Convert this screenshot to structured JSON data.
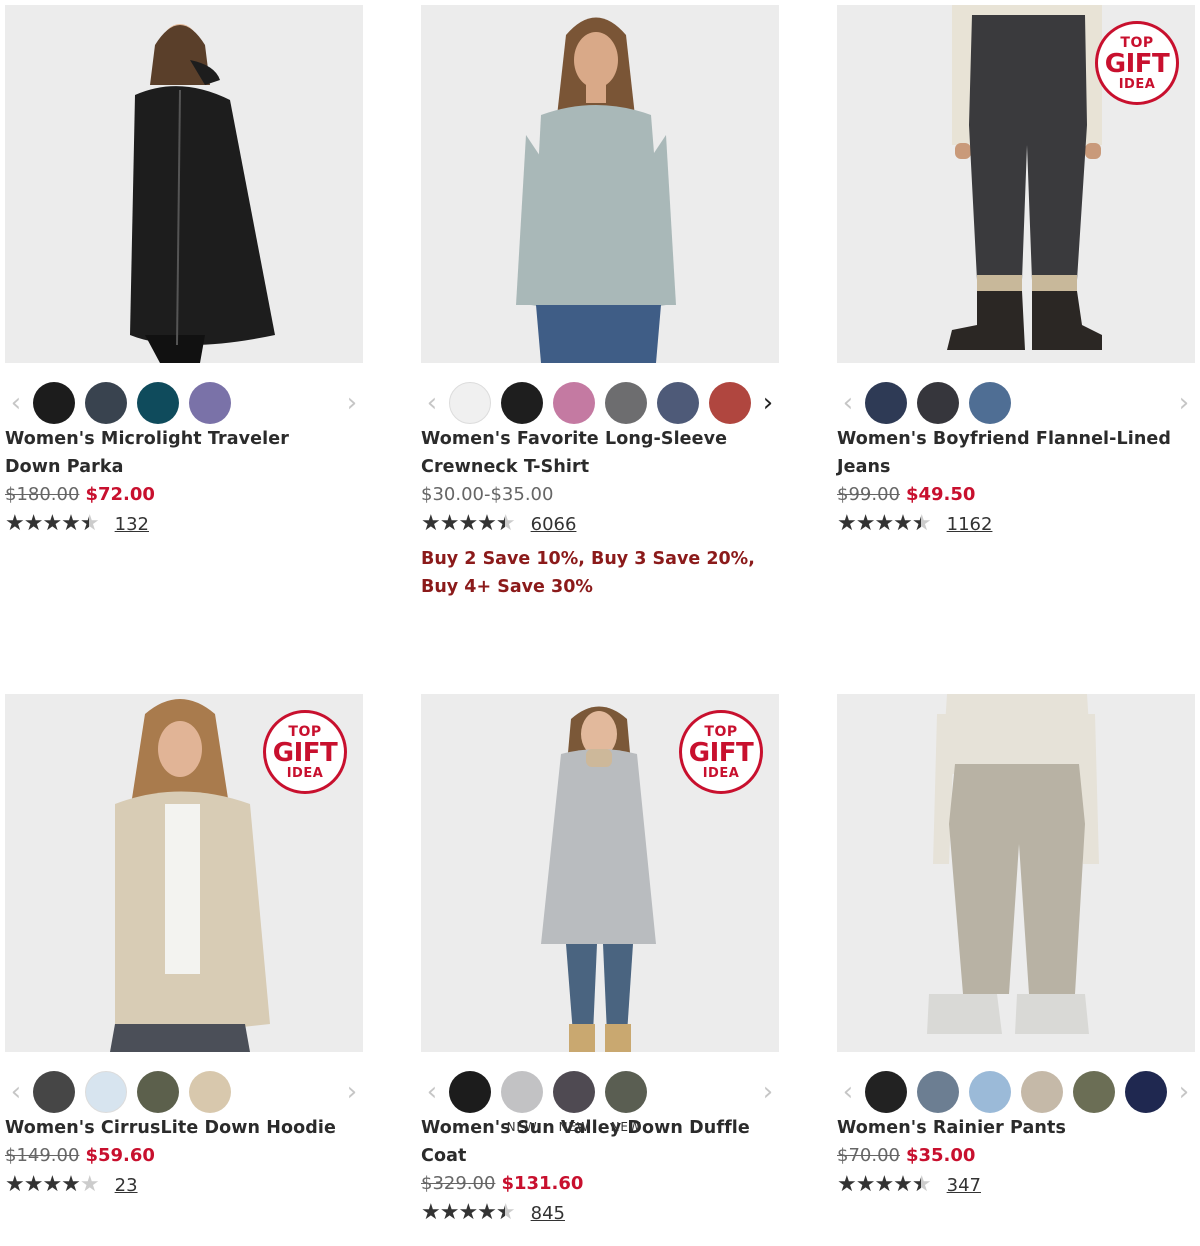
{
  "products": [
    {
      "title": "Women's Microlight Traveler Down Parka",
      "was_price": "$180.00",
      "now_price": "$72.00",
      "rating": 4.5,
      "review_count": "132",
      "badge": null,
      "swatches": [
        "#1c1c1c",
        "#39434f",
        "#0f4b5c",
        "#7a72a8"
      ],
      "figure": {
        "body": "#1d1d1d",
        "legs": "#111111",
        "skin": "#e2b99a",
        "hair": "#5a3f2a"
      }
    },
    {
      "title": "Women's Favorite Long-Sleeve Crewneck T-Shirt",
      "price_range": "$30.00-$35.00",
      "rating": 4.5,
      "review_count": "6066",
      "promo": "Buy 2 Save 10%, Buy 3 Save 20%, Buy 4+ Save 30%",
      "badge": null,
      "swatches": [
        "#f0f0f0",
        "#1e1e1e",
        "#c47aa2",
        "#6d6d6f",
        "#4e5a78",
        "#b0463f"
      ],
      "figure": {
        "body": "#a9b8b8",
        "legs": "#3f5d86",
        "skin": "#d9a988",
        "hair": "#7a5536"
      }
    },
    {
      "title": "Women's Boyfriend Flannel-Lined Jeans",
      "was_price": "$99.00",
      "now_price": "$49.50",
      "rating": 4.5,
      "review_count": "1162",
      "badge": {
        "top": "TOP",
        "mid": "GIFT",
        "bottom": "IDEA"
      },
      "swatches": [
        "#2e3a55",
        "#36363c",
        "#4f6e94"
      ],
      "figure": {
        "body": "#3a3a3d",
        "legs": "#3a3a3d",
        "skin": "#c99a7a",
        "hair": "#e8e3d6"
      }
    },
    {
      "title": "Women's CirrusLite Down Hoodie",
      "was_price": "$149.00",
      "now_price": "$59.60",
      "rating": 4,
      "review_count": "23",
      "badge": {
        "top": "TOP",
        "mid": "GIFT",
        "bottom": "IDEA"
      },
      "swatches": [
        "#464646",
        "#d7e4ef",
        "#5c604c",
        "#d8c8ad"
      ],
      "figure": {
        "body": "#d8ccb5",
        "legs": "#4b4f58",
        "skin": "#e1b496",
        "hair": "#a97b4d"
      }
    },
    {
      "title": "Women's Sun Valley Down Duffle Coat",
      "was_price": "$329.00",
      "now_price": "$131.60",
      "rating": 4.5,
      "review_count": "845",
      "badge": {
        "top": "TOP",
        "mid": "GIFT",
        "bottom": "IDEA"
      },
      "swatches": [
        "#1c1c1c",
        "#c2c2c4",
        "#4f4a52",
        "#5a5e52"
      ],
      "swatch_tags": [
        "",
        "NEW",
        "NEW",
        "NEW"
      ],
      "figure": {
        "body": "#b9bcbf",
        "legs": "#4a6480",
        "skin": "#e2b99c",
        "hair": "#7b5838"
      }
    },
    {
      "title": "Women's Rainier Pants",
      "was_price": "$70.00",
      "now_price": "$35.00",
      "rating": 4.5,
      "review_count": "347",
      "badge": null,
      "swatches": [
        "#222222",
        "#6c7e92",
        "#9bbad8",
        "#c5b9a8",
        "#6b6e55",
        "#1f2850"
      ],
      "figure": {
        "body": "#b8b2a4",
        "legs": "#b8b2a4",
        "skin": "#e6d9c8",
        "hair": "#e6e2d8"
      }
    }
  ],
  "colors": {
    "sale": "#c8102e",
    "promo": "#8b1a1a",
    "card_bg": "#ececec"
  }
}
